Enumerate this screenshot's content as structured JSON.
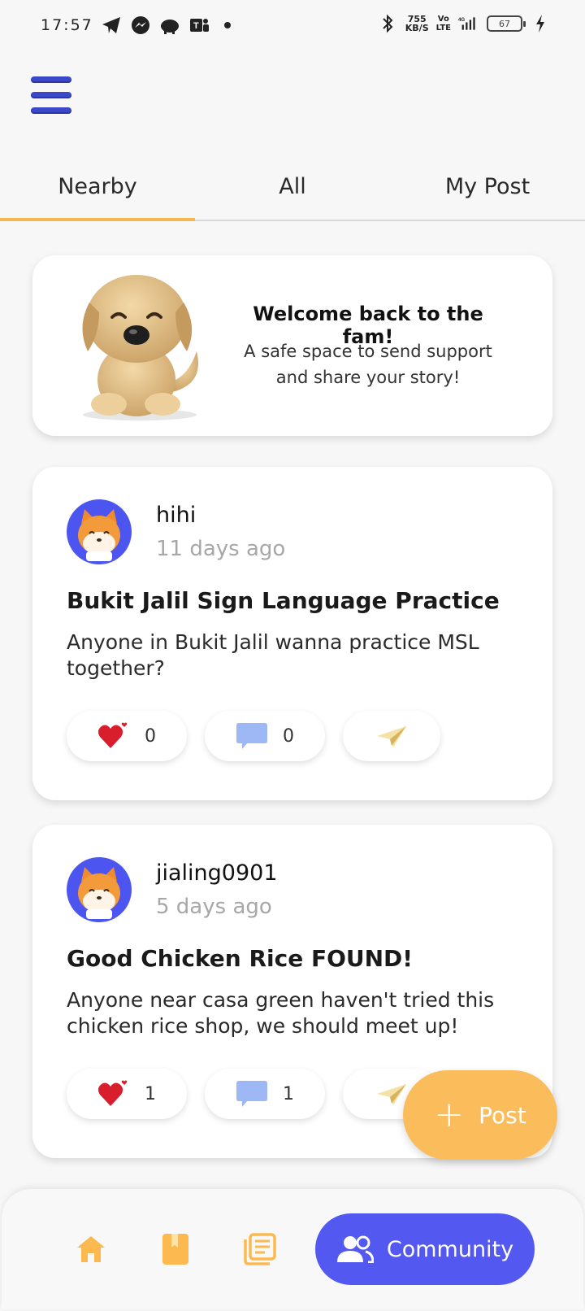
{
  "status_bar": {
    "time": "17:57",
    "speed_value": "755",
    "speed_unit": "KB/S",
    "volte_top": "Vo",
    "volte_bottom": "LTE",
    "network": "4G",
    "battery": "67"
  },
  "tabs": [
    {
      "label": "Nearby",
      "active": true
    },
    {
      "label": "All",
      "active": false
    },
    {
      "label": "My Post",
      "active": false
    }
  ],
  "welcome": {
    "title": "Welcome back to the fam!",
    "subtitle_line1": "A safe space to send support",
    "subtitle_line2": "and share your story!"
  },
  "posts": [
    {
      "username": "hihi",
      "time_ago": "11 days ago",
      "title": "Bukit Jalil Sign Language Practice",
      "body": "Anyone in Bukit Jalil wanna practice MSL together?",
      "likes": "0",
      "comments": "0"
    },
    {
      "username": "jialing0901",
      "time_ago": "5 days ago",
      "title": "Good Chicken Rice FOUND!",
      "body": "Anyone near casa green haven't tried this chicken rice shop, we should meet up!",
      "likes": "1",
      "comments": "1"
    }
  ],
  "fab": {
    "label": "Post"
  },
  "bottom_nav": {
    "items": [
      {
        "icon": "home-icon"
      },
      {
        "icon": "book-icon"
      },
      {
        "icon": "notes-icon"
      }
    ],
    "active_label": "Community"
  },
  "colors": {
    "accent": "#f6b94d",
    "primary": "#5358f0",
    "menu": "#3a48c9"
  }
}
